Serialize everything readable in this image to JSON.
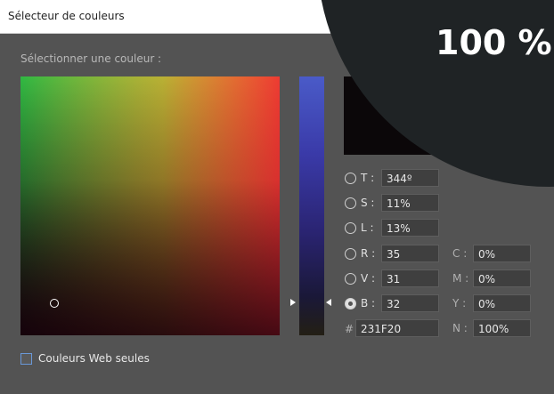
{
  "window": {
    "title": "Sélecteur de couleurs"
  },
  "overlay": {
    "text": "100 %"
  },
  "picker": {
    "label": "Sélectionner une couleur :"
  },
  "hsb": [
    {
      "label": "T :",
      "value": "344º"
    },
    {
      "label": "S :",
      "value": "11%"
    },
    {
      "label": "L :",
      "value": "13%"
    }
  ],
  "rgb": [
    {
      "label": "R :",
      "value": "35"
    },
    {
      "label": "V :",
      "value": "31"
    },
    {
      "label": "B :",
      "value": "32"
    }
  ],
  "cmyk": [
    {
      "label": "C :",
      "value": "0%"
    },
    {
      "label": "M :",
      "value": "0%"
    },
    {
      "label": "Y :",
      "value": "0%"
    },
    {
      "label": "N :",
      "value": "100%"
    }
  ],
  "hex": {
    "symbol": "#",
    "value": "231F20"
  },
  "web_only": {
    "label": "Couleurs Web seules",
    "checked": false
  },
  "colors": {
    "current": "#231F20",
    "background": "#535353",
    "overlay": "#1F2325",
    "accent": "#6A98D8"
  }
}
